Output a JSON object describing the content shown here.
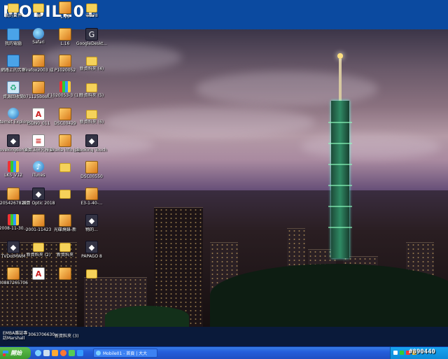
{
  "banner": {
    "logo_text": "MOBILE01"
  },
  "top_strip": [
    {
      "label": "我的文件",
      "icon": "folder-icon"
    },
    {
      "label": "捐",
      "icon": "folder-icon"
    },
    {
      "label": "L.15",
      "icon": "image-icon"
    },
    {
      "label": "中278",
      "icon": "folder-icon"
    }
  ],
  "desktop_icons": [
    {
      "label": "我的電腦",
      "icon": "my-computer-icon"
    },
    {
      "label": "Safari",
      "icon": "safari-icon"
    },
    {
      "label": "L.16",
      "icon": "image-icon"
    },
    {
      "label": "GoogleDeskt...",
      "icon": "google-desktop-icon"
    },
    {
      "label": "網路上的芳鄰",
      "icon": "network-icon"
    },
    {
      "label": "Firefox2003 成",
      "icon": "image-icon"
    },
    {
      "label": "P1020052",
      "icon": "image-icon"
    },
    {
      "label": "新資料夾 (4)",
      "icon": "folder-icon"
    },
    {
      "label": "資源回收筒",
      "icon": "recycle-bin-icon"
    },
    {
      "label": "071125book...",
      "icon": "image-icon"
    },
    {
      "label": "F1020053-3 (1).jp",
      "icon": "winrar-icon"
    },
    {
      "label": "新資料夾 (5)",
      "icon": "folder-icon"
    },
    {
      "label": "Internet Explorer",
      "icon": "internet-explorer-icon"
    },
    {
      "label": "ISDN0_011",
      "icon": "pdf-icon"
    },
    {
      "label": "DSC00429",
      "icon": "image-icon"
    },
    {
      "label": "新資料夾 (6)",
      "icon": "folder-icon"
    },
    {
      "label": "Ilovekingdom...",
      "icon": "app-icon"
    },
    {
      "label": "演算法研究報告",
      "icon": "document-icon"
    },
    {
      "label": "Wuxia info.jpg",
      "icon": "image-icon"
    },
    {
      "label": "Booking Touch",
      "icon": "app-icon"
    },
    {
      "label": "LKS_V12",
      "icon": "winrar-icon"
    },
    {
      "label": "iTunes",
      "icon": "itunes-icon"
    },
    {
      "label": "",
      "icon": "folder-icon"
    },
    {
      "label": "DSC00550",
      "icon": "image-icon"
    },
    {
      "label": "2054267820",
      "icon": "image-icon"
    },
    {
      "label": "演算 Optic 2018",
      "icon": "app-icon"
    },
    {
      "label": "",
      "icon": "folder-icon"
    },
    {
      "label": "E3-1-40-...",
      "icon": "image-icon"
    },
    {
      "label": "2008-11-30...",
      "icon": "multicolor-icon"
    },
    {
      "label": "2001-11423",
      "icon": "image-icon"
    },
    {
      "label": "光碟燒錄-新",
      "icon": "image-icon"
    },
    {
      "label": "物的...",
      "icon": "app-icon"
    },
    {
      "label": "TVDotMWM",
      "icon": "app-icon"
    },
    {
      "label": "新資料夾 (2)",
      "icon": "folder-icon"
    },
    {
      "label": "新資料夾",
      "icon": "folder-icon"
    },
    {
      "label": "PAPAGO 8",
      "icon": "app-icon"
    },
    {
      "label": "30887265706",
      "icon": "image-icon"
    },
    {
      "label": "",
      "icon": "pdf-icon"
    },
    {
      "label": "",
      "icon": "image-icon"
    },
    {
      "label": "",
      "icon": "folder-icon"
    }
  ],
  "bottom_labels": {
    "col1": "EMBA雜誌專 訪Marshall",
    "col2": "3063706630...",
    "col3": "新資料夾 (3)"
  },
  "taskbar": {
    "start_label": "開始",
    "task_label": "Mobile01 - 首頁 | 大大",
    "watermark": "#890440"
  }
}
